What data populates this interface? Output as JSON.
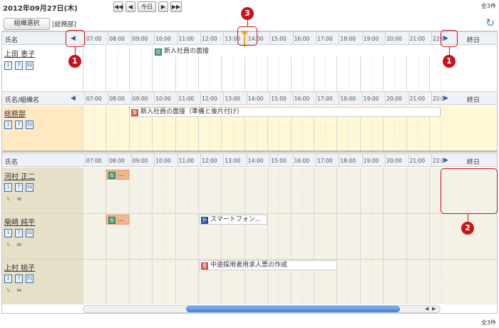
{
  "header": {
    "date": "2012年09月27日(木)",
    "nav": {
      "first": "◀◀",
      "prev": "◀",
      "today": "今日",
      "next": "▶",
      "last": "▶▶"
    },
    "count_top": "全3件",
    "count_bottom": "全3件"
  },
  "toolbar": {
    "org_select": "組織選択",
    "org_name": "[総務部]",
    "refresh_icon": "refresh-icon"
  },
  "times": [
    "07:00",
    "08:00",
    "09:00",
    "10:00",
    "11:00",
    "12:00",
    "13:00",
    "14:00",
    "15:00",
    "16:00",
    "17:00",
    "18:00",
    "19:00",
    "20:00",
    "21:00",
    "22:0"
  ],
  "section1": {
    "header_label": "氏名",
    "allday_label": "終日",
    "people": [
      {
        "name": "上田 恵子",
        "events": [
          {
            "tag": "仮",
            "label": "新入社員の面接"
          }
        ]
      }
    ]
  },
  "section2": {
    "header_label": "氏名/組織名",
    "allday_label": "終日",
    "orgs": [
      {
        "name": "総務部",
        "events": [
          {
            "tag": "重",
            "label": "新入社員の面接（準備と後片付け）"
          }
        ]
      }
    ]
  },
  "section3": {
    "header_label": "氏名",
    "allday_label": "終日",
    "people": [
      {
        "name": "河村 正二",
        "events": [
          {
            "tag": "仮",
            "label": "..."
          }
        ]
      },
      {
        "name": "柴崎 純平",
        "events": [
          {
            "tag": "仮",
            "label": "..."
          },
          {
            "tag": "外",
            "label": "スマートフォン..."
          }
        ]
      },
      {
        "name": "上村 桃子",
        "events": [
          {
            "tag": "重",
            "label": "中途採用者用求人票の作成"
          }
        ]
      }
    ]
  },
  "cal_icons": {
    "day": "1",
    "week": "7",
    "month": "31"
  },
  "callouts": {
    "c1": "1",
    "c2": "2",
    "c3": "3"
  }
}
